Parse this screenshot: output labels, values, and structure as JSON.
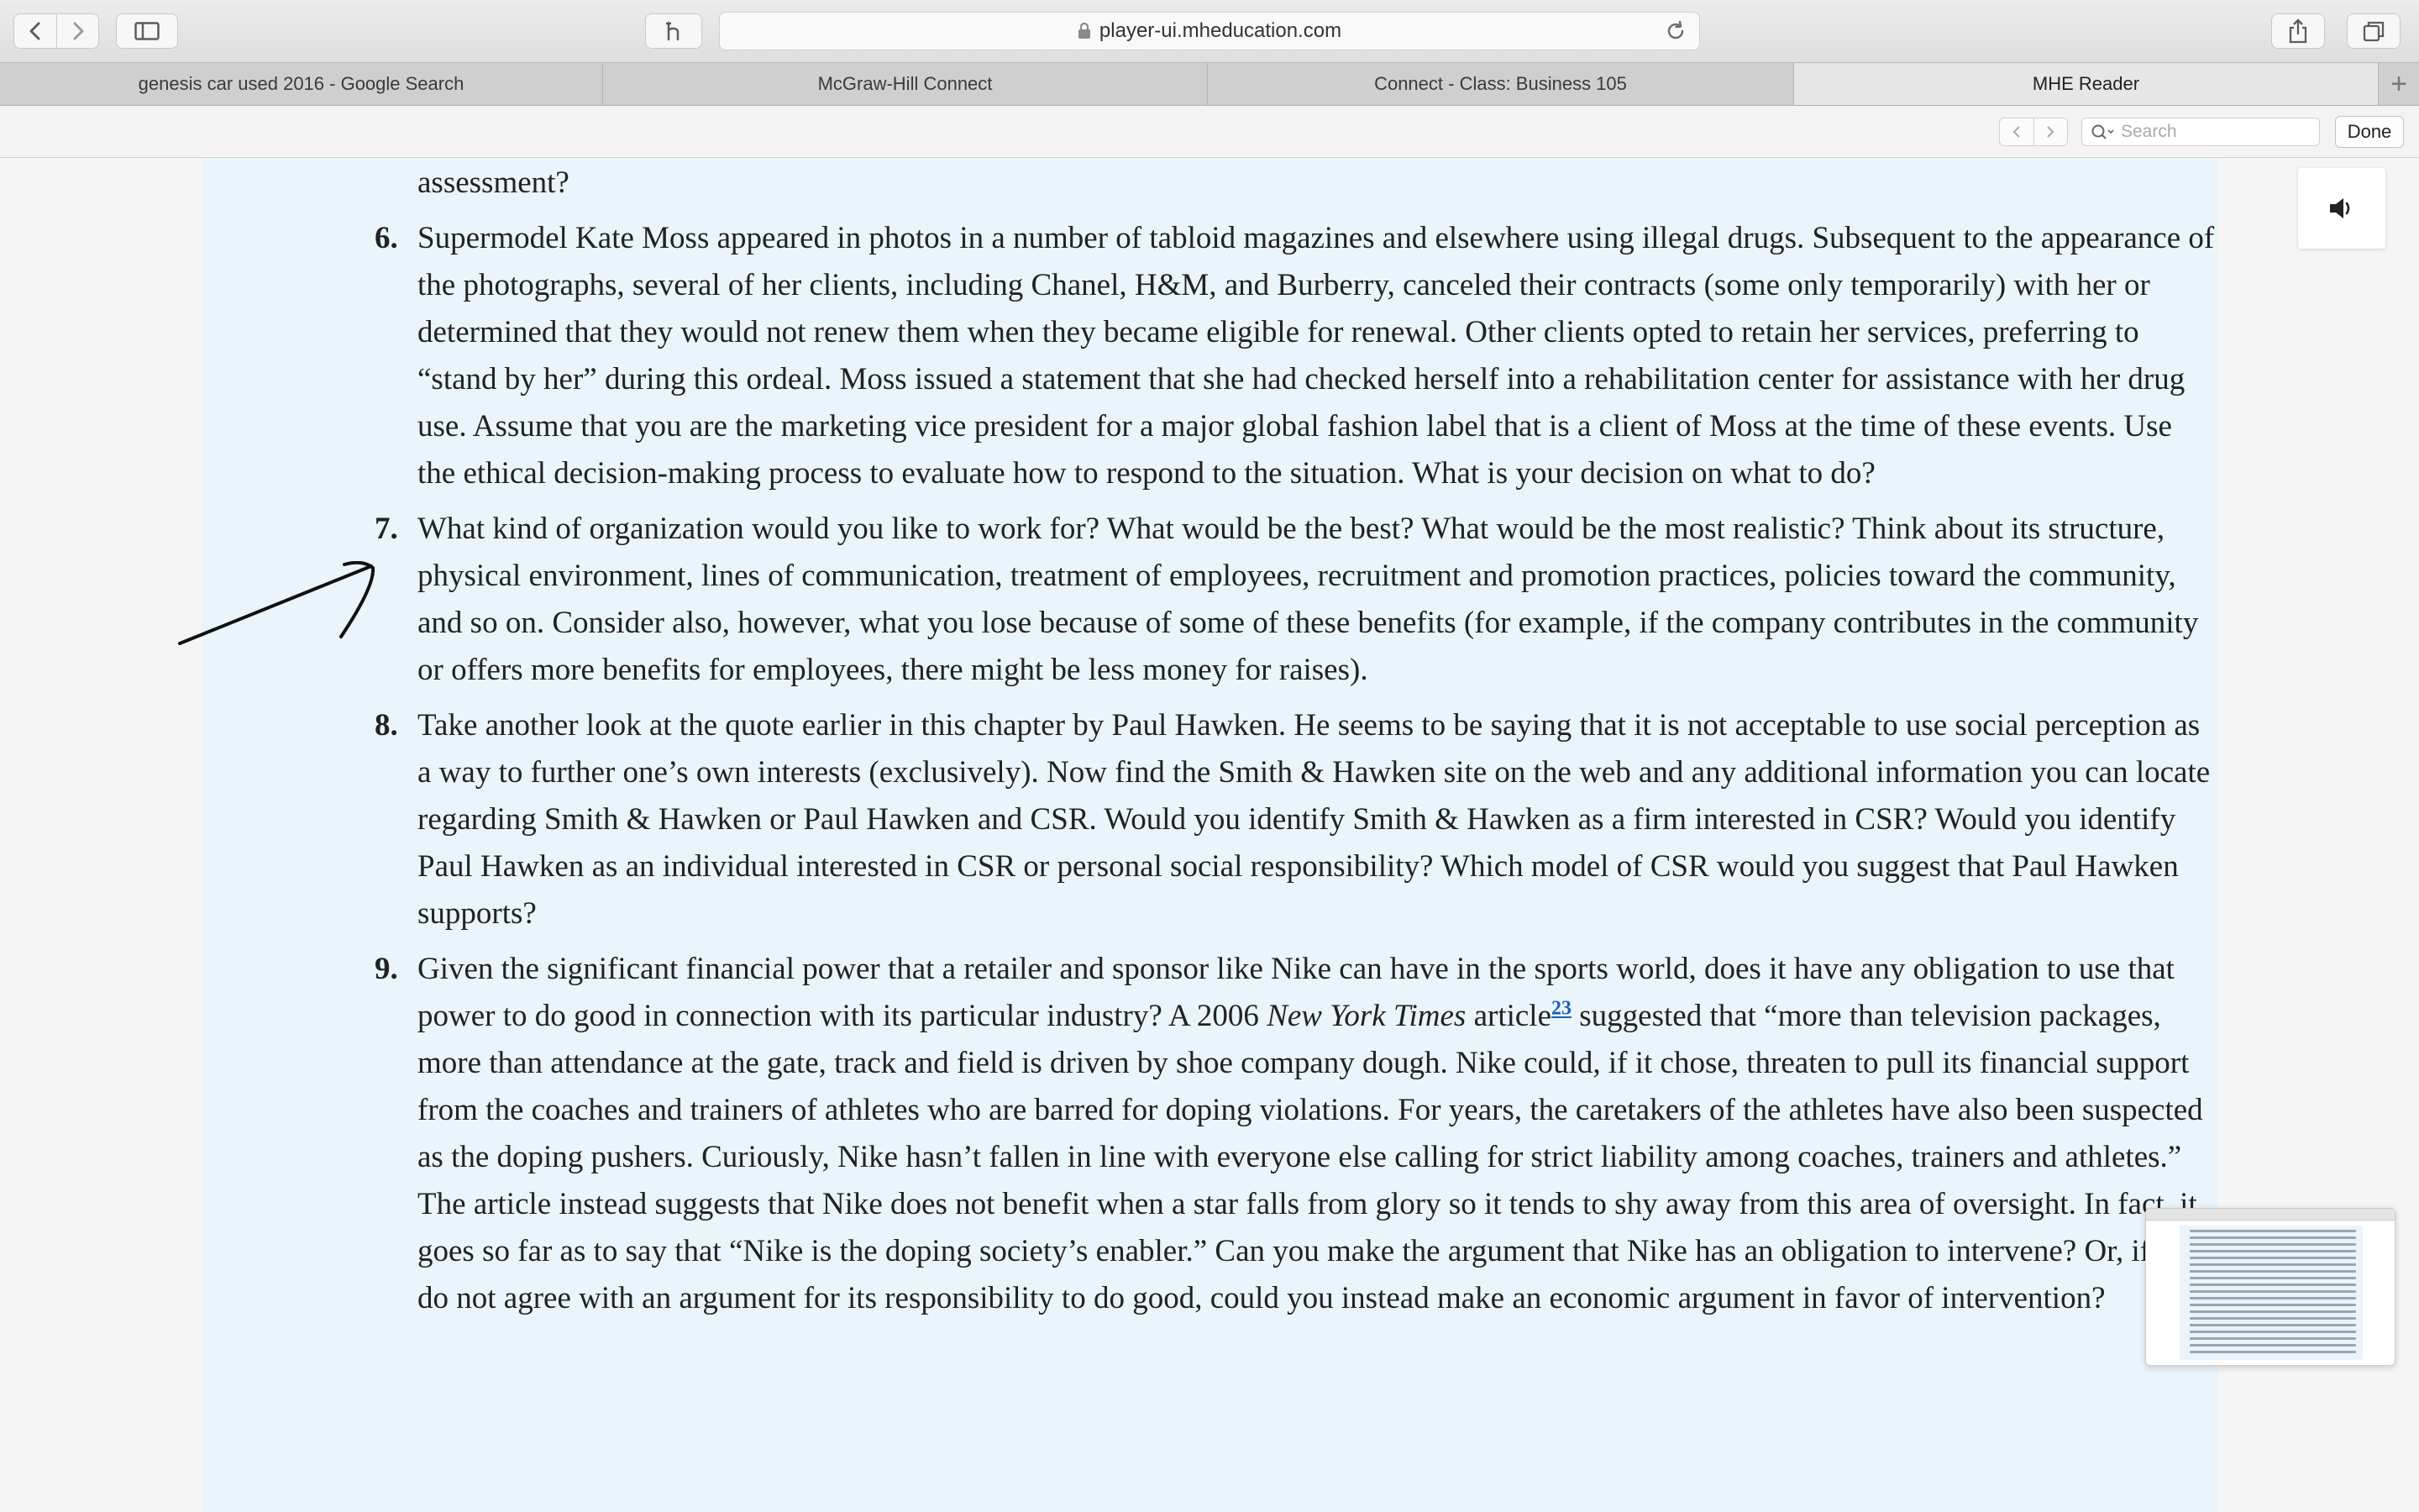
{
  "browser": {
    "url": "player-ui.mheducation.com",
    "tabs": [
      {
        "label": "genesis car used 2016 - Google Search",
        "active": false
      },
      {
        "label": "McGraw-Hill Connect",
        "active": false
      },
      {
        "label": "Connect - Class: Business 105",
        "active": false
      },
      {
        "label": "MHE Reader",
        "active": true
      }
    ],
    "new_tab_symbol": "+"
  },
  "findbar": {
    "search_placeholder": "Search",
    "done_label": "Done"
  },
  "reader": {
    "top_fragment": "assessment?",
    "questions": [
      {
        "number": "6.",
        "text": "Supermodel Kate Moss appeared in photos in a number of tabloid magazines and elsewhere using illegal drugs. Subsequent to the appearance of the photographs, several of her clients, including Chanel, H&M, and Burberry, canceled their contracts (some only temporarily) with her or determined that they would not renew them when they became eligible for renewal. Other clients opted to retain her services, preferring to “stand by her” during this ordeal. Moss issued a statement that she had checked herself into a rehabilitation center for assistance with her drug use. Assume that you are the marketing vice president for a major global fashion label that is a client of Moss at the time of these events. Use the ethical decision-making process to evaluate how to respond to the situation. What is your decision on what to do?"
      },
      {
        "number": "7.",
        "text": "What kind of organization would you like to work for? What would be the best? What would be the most realistic? Think about its structure, physical environment, lines of communication, treatment of employees, recruitment and promotion practices, policies toward the community, and so on. Consider also, however, what you lose because of some of these benefits (for example, if the company contributes in the community or offers more benefits for employees, there might be less money for raises)."
      },
      {
        "number": "8.",
        "text": "Take another look at the quote earlier in this chapter by Paul Hawken. He seems to be saying that it is not acceptable to use social perception as a way to further one’s own interests (exclusively). Now find the Smith & Hawken site on the web and any additional information you can locate regarding Smith & Hawken or Paul Hawken and CSR. Would you identify Smith & Hawken as a firm interested in CSR? Would you identify Paul Hawken as an individual interested in CSR or personal social responsibility? Which model of CSR would you suggest that Paul Hawken supports?"
      },
      {
        "number": "9.",
        "text_before": "Given the significant financial power that a retailer and sponsor like Nike can have in the sports world, does it have any obligation to use that power to do good in connection with its particular industry? A 2006 ",
        "italic": "New York Times",
        "text_mid": " article",
        "footnote": "23",
        "text_after": " suggested that “more than television packages, more than attendance at the gate, track and field is driven by shoe company dough. Nike could, if it chose, threaten to pull its financial support from the coaches and trainers of athletes who are barred for doping violations. For years, the caretakers of the athletes have also been suspected as the doping pushers. Curiously, Nike hasn’t fallen in line with everyone else calling for strict liability among coaches, trainers and athletes.” The article instead suggests that Nike does not benefit when a star falls from glory so it tends to shy away from this area of oversight. In fact, it goes so far as to say that “Nike is the doping society’s enabler.” Can you make the argument that Nike has an obligation to intervene? Or, if you do not agree with an argument for its responsibility to do good, could you instead make an economic argument in favor of intervention?"
      }
    ]
  },
  "icons": {
    "back": "chevron-left-icon",
    "forward": "chevron-right-icon",
    "sidebar": "sidebar-icon",
    "reader": "reader-icon",
    "lock": "lock-icon",
    "reload": "reload-icon",
    "share": "share-icon",
    "tabs": "tabs-overview-icon",
    "audio": "speaker-icon",
    "search": "magnifier-icon"
  }
}
